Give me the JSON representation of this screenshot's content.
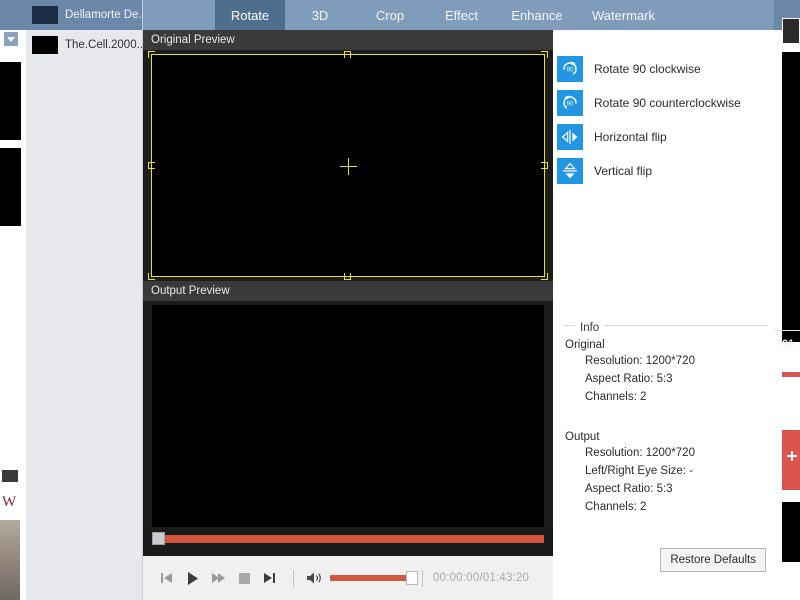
{
  "app": {
    "tabs": [
      {
        "label": "Rotate",
        "active": true
      },
      {
        "label": "3D",
        "active": false
      },
      {
        "label": "Crop",
        "active": false
      },
      {
        "label": "Effect",
        "active": false
      },
      {
        "label": "Enhance",
        "active": false
      },
      {
        "label": "Watermark",
        "active": false
      }
    ],
    "accent_color": "#2196e3",
    "tabbar_color": "#7f9cba",
    "active_tab_color": "#4e6e8e",
    "selection_color": "#e8e22a",
    "slider_color": "#d4563f"
  },
  "file_list": {
    "items": [
      {
        "name": "Dellamorte De..",
        "selected": true
      },
      {
        "name": "The.Cell.2000..",
        "selected": false
      }
    ]
  },
  "previews": {
    "original_title": "Original Preview",
    "output_title": "Output Preview"
  },
  "rotate_options": [
    {
      "label": "Rotate 90 clockwise",
      "icon": "rotate-clockwise-90-icon",
      "badge": "90"
    },
    {
      "label": "Rotate 90 counterclockwise",
      "icon": "rotate-counterclockwise-90-icon",
      "badge": "90"
    },
    {
      "label": "Horizontal flip",
      "icon": "horizontal-flip-icon",
      "badge": ""
    },
    {
      "label": "Vertical flip",
      "icon": "vertical-flip-icon",
      "badge": ""
    }
  ],
  "info": {
    "legend": "Info",
    "original_heading": "Original",
    "original_lines": [
      "Resolution: 1200*720",
      "Aspect Ratio: 5:3",
      "Channels: 2"
    ],
    "output_heading": "Output",
    "output_lines": [
      "Resolution: 1200*720",
      "Left/Right Eye Size: -",
      "Aspect Ratio: 5:3",
      "Channels: 2"
    ]
  },
  "buttons": {
    "restore_defaults": "Restore Defaults"
  },
  "transport": {
    "time": "00:00:00/01:43:20",
    "controls": [
      "previous-button",
      "play-button",
      "fast-forward-button",
      "stop-button",
      "next-button"
    ]
  },
  "background": {
    "right_snippet": "01"
  }
}
